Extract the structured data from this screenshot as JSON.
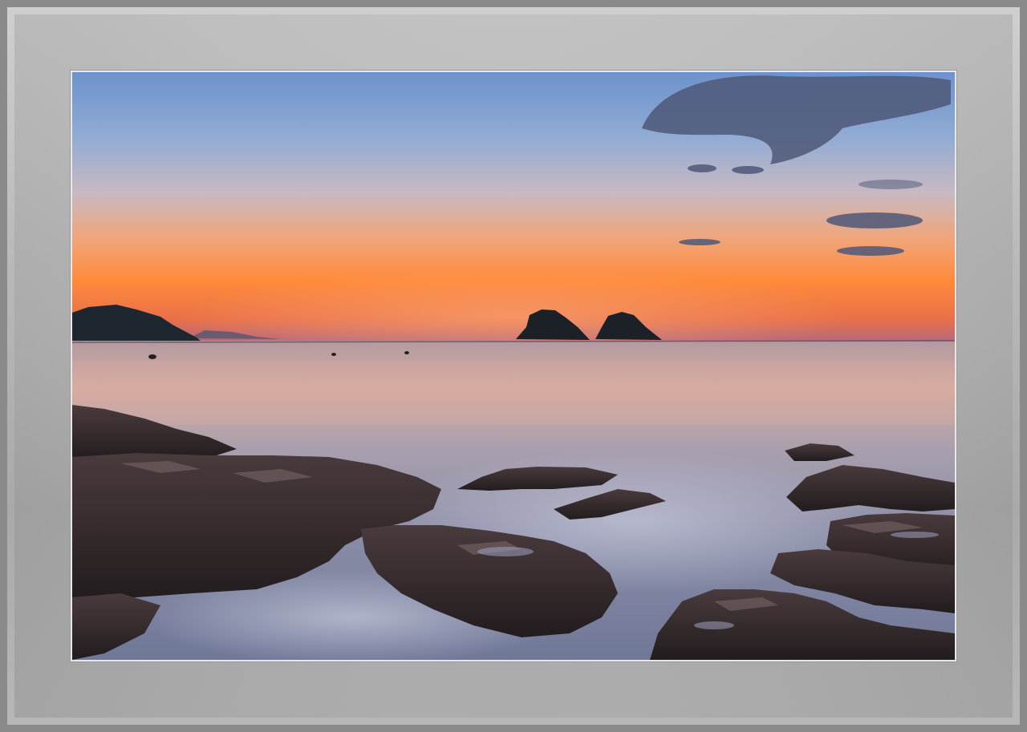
{
  "scene": {
    "type": "photograph",
    "subject": "sunset-seascape",
    "colors": {
      "frame": "#b5b5b5",
      "frame_border": "#8a8a8a",
      "sky_top": "#6f97cf",
      "sky_mid": "#c6b8bf",
      "sky_horizon": "#ff8a3c",
      "sea": "#8f8fa5",
      "rock": "#2c2526"
    }
  }
}
